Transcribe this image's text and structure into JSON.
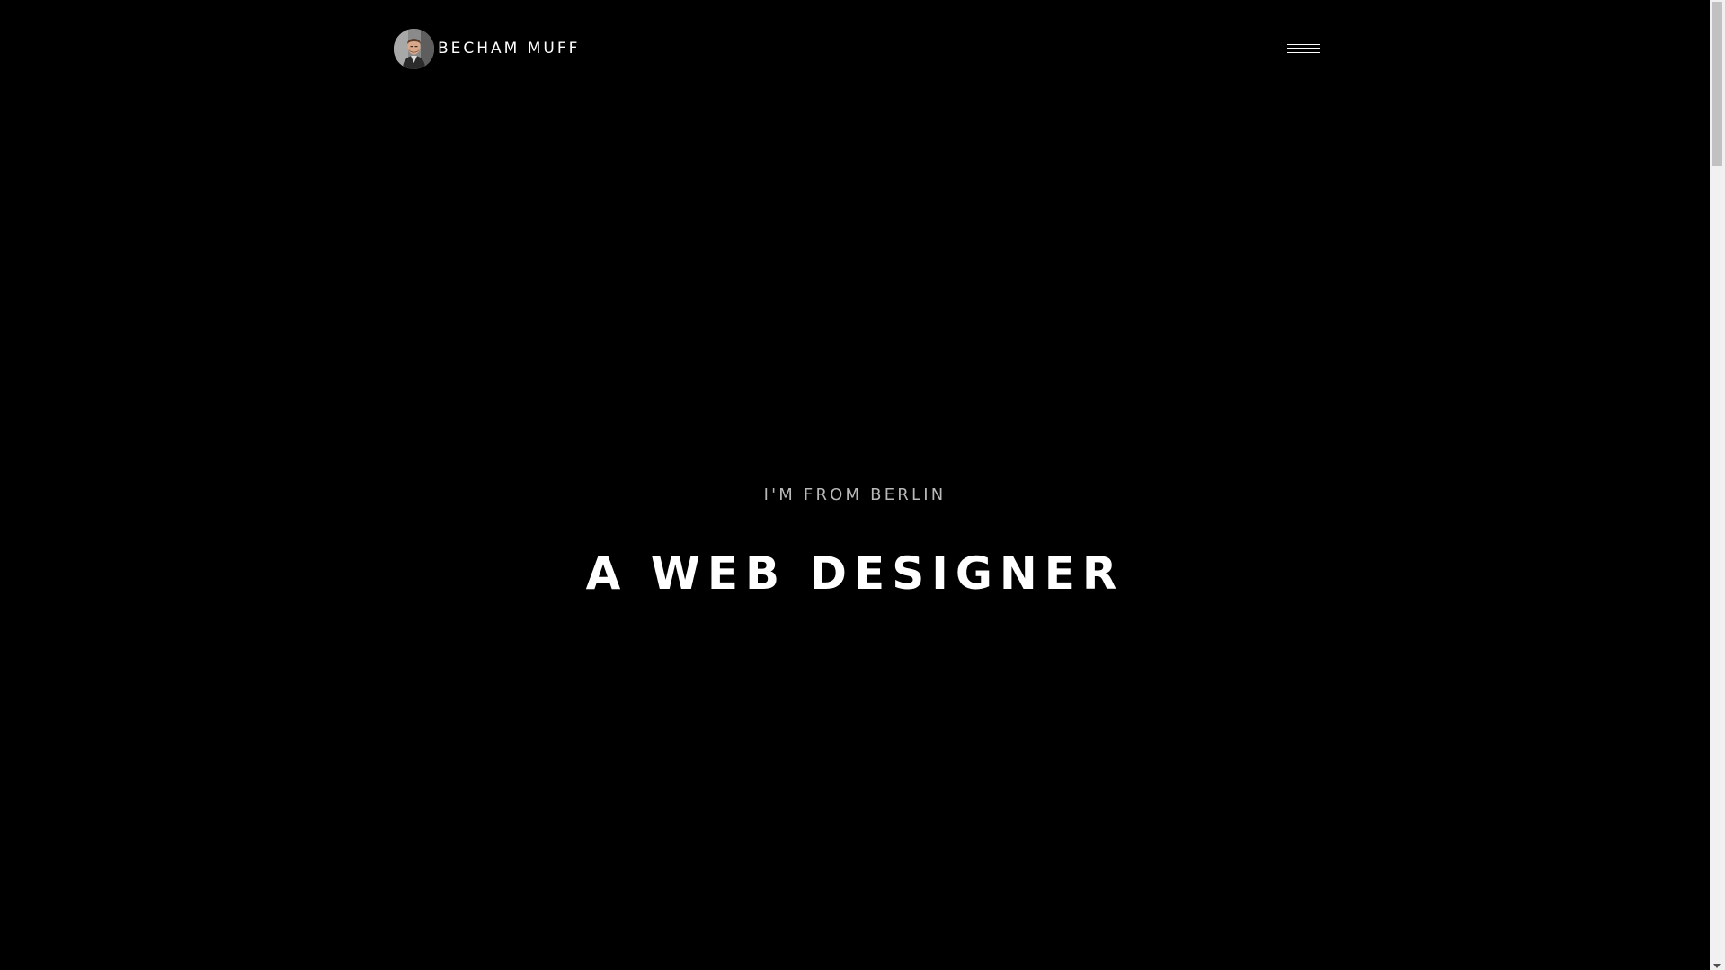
{
  "header": {
    "brand_name": "BECHAM MUFF",
    "avatar_icon": "portrait-avatar",
    "menu_icon": "hamburger-menu-icon"
  },
  "hero": {
    "subtitle": "I'M FROM BERLIN",
    "title": "A WEB DESIGNER"
  },
  "colors": {
    "background": "#000000",
    "text_primary": "#ffffff",
    "text_secondary": "#b9b9b9",
    "scrollbar_track": "#f1f1f1",
    "scrollbar_thumb": "#c1c1c1"
  }
}
